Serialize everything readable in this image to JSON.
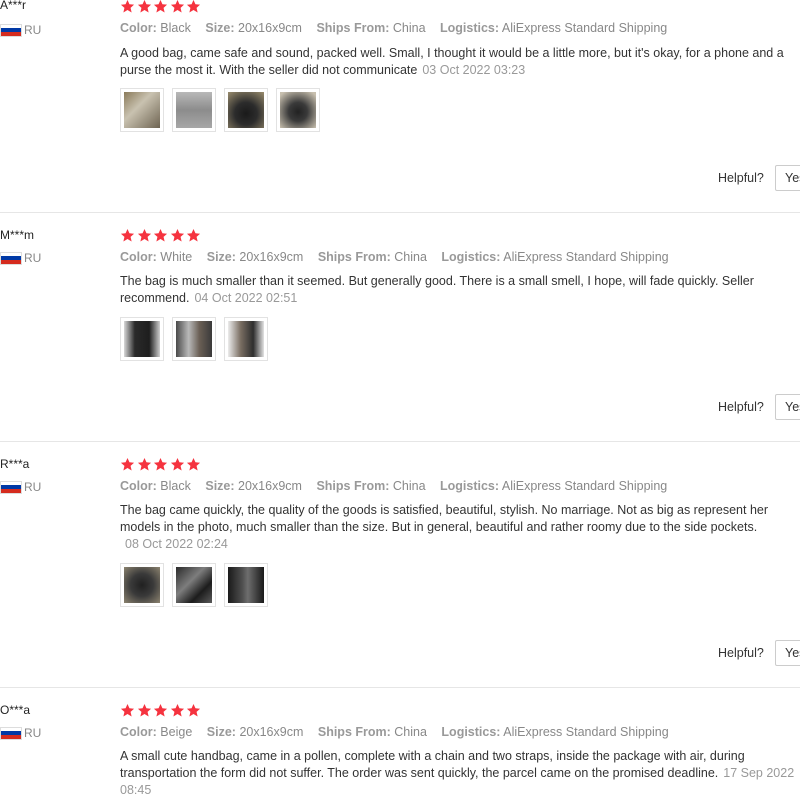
{
  "colors": {
    "star": "#f5333f",
    "flag_white": "#ffffff",
    "flag_blue": "#0039a6",
    "flag_red": "#d52b1e"
  },
  "labels": {
    "color": "Color:",
    "size": "Size:",
    "ships_from": "Ships From:",
    "logistics": "Logistics:",
    "helpful": "Helpful?",
    "yes": "Yes"
  },
  "reviews": [
    {
      "user": "A***r",
      "country": "RU",
      "rating": 5,
      "color": "Black",
      "size": "20x16x9cm",
      "ships_from": "China",
      "logistics": "AliExpress Standard Shipping",
      "text": "A good bag, came safe and sound, packed well. Small, I thought it would be a little more, but it's okay, for a phone and a purse the most it. With the seller did not communicate",
      "date": "03 Oct 2022 03:23",
      "photos": [
        "photo-bag-wrapped",
        "photo-bag-gray",
        "photo-bag-black",
        "photo-bag-strap"
      ]
    },
    {
      "user": "M***m",
      "country": "RU",
      "rating": 5,
      "color": "White",
      "size": "20x16x9cm",
      "ships_from": "China",
      "logistics": "AliExpress Standard Shipping",
      "text": "The bag is much smaller than it seemed. But generally good. There is a small smell, I hope, will fade quickly. Seller recommend.",
      "date": "04 Oct 2022 02:51",
      "photos": [
        "photo-bag-dark",
        "photo-bag-open",
        "photo-bag-side"
      ]
    },
    {
      "user": "R***a",
      "country": "RU",
      "rating": 5,
      "color": "Black",
      "size": "20x16x9cm",
      "ships_from": "China",
      "logistics": "AliExpress Standard Shipping",
      "text": "The bag came quickly, the quality of the goods is satisfied, beautiful, stylish. No marriage. Not as big as represent her models in the photo, much smaller than the size. But in general, beautiful and rather roomy due to the side pockets.",
      "date": "08 Oct 2022 02:24",
      "photos": [
        "photo-bag-front",
        "photo-bag-pocket",
        "photo-bag-back"
      ]
    },
    {
      "user": "O***a",
      "country": "RU",
      "rating": 5,
      "color": "Beige",
      "size": "20x16x9cm",
      "ships_from": "China",
      "logistics": "AliExpress Standard Shipping",
      "text": "A small cute handbag, came in a pollen, complete with a chain and two straps, inside the package with air, during transportation the form did not suffer. The order was sent quickly, the parcel came on the promised deadline.",
      "date": "17 Sep 2022 08:45",
      "photos": []
    }
  ]
}
